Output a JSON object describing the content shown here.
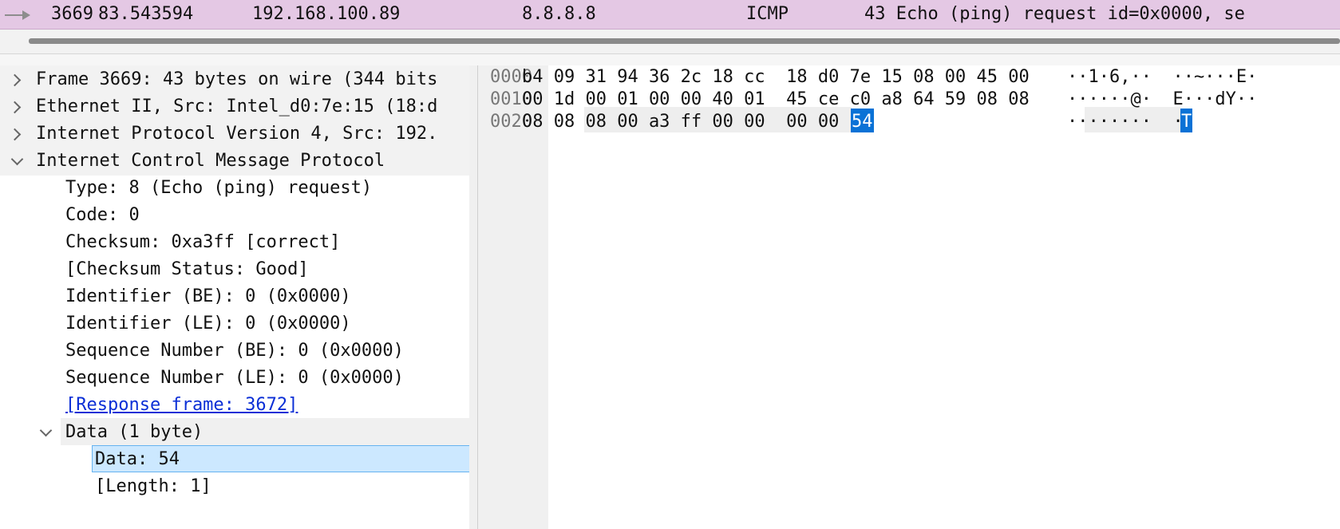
{
  "packet_list": {
    "row": {
      "no": "3669",
      "time": "83.543594",
      "source": "192.168.100.89",
      "destination": "8.8.8.8",
      "protocol": "ICMP",
      "length_info": "43 Echo (ping) request  id=0x0000, se"
    }
  },
  "details": {
    "frame": "Frame 3669: 43 bytes on wire (344 bits",
    "ethernet": "Ethernet II, Src: Intel_d0:7e:15 (18:d",
    "ip": "Internet Protocol Version 4, Src: 192.",
    "icmp": "Internet Control Message Protocol",
    "icmp_fields": [
      "Type: 8 (Echo (ping) request)",
      "Code: 0",
      "Checksum: 0xa3ff [correct]",
      "[Checksum Status: Good]",
      "Identifier (BE): 0 (0x0000)",
      "Identifier (LE): 0 (0x0000)",
      "Sequence Number (BE): 0 (0x0000)",
      "Sequence Number (LE): 0 (0x0000)"
    ],
    "response_link": "[Response frame: 3672]",
    "data_header": "Data (1 byte)",
    "data_value": "Data: 54",
    "data_length": "[Length: 1]"
  },
  "bytes": {
    "offsets": [
      "0000",
      "0010",
      "0020"
    ],
    "hex": [
      "b4 09 31 94 36 2c 18 cc  18 d0 7e 15 08 00 45 00",
      "00 1d 00 01 00 00 40 01  45 ce c0 a8 64 59 08 08",
      "08 08 08 00 a3 ff 00 00  00 00"
    ],
    "selected_hex": "54",
    "ascii": [
      "··1·6,··  ··~···E·",
      "······@·  E···dY··",
      "········  ··"
    ],
    "selected_ascii": "T"
  },
  "colors": {
    "packet_row_bg": "#e4c8e4",
    "selection": "#0a72d6",
    "highlight_row": "#cce8ff",
    "link": "#0b2fd6"
  }
}
